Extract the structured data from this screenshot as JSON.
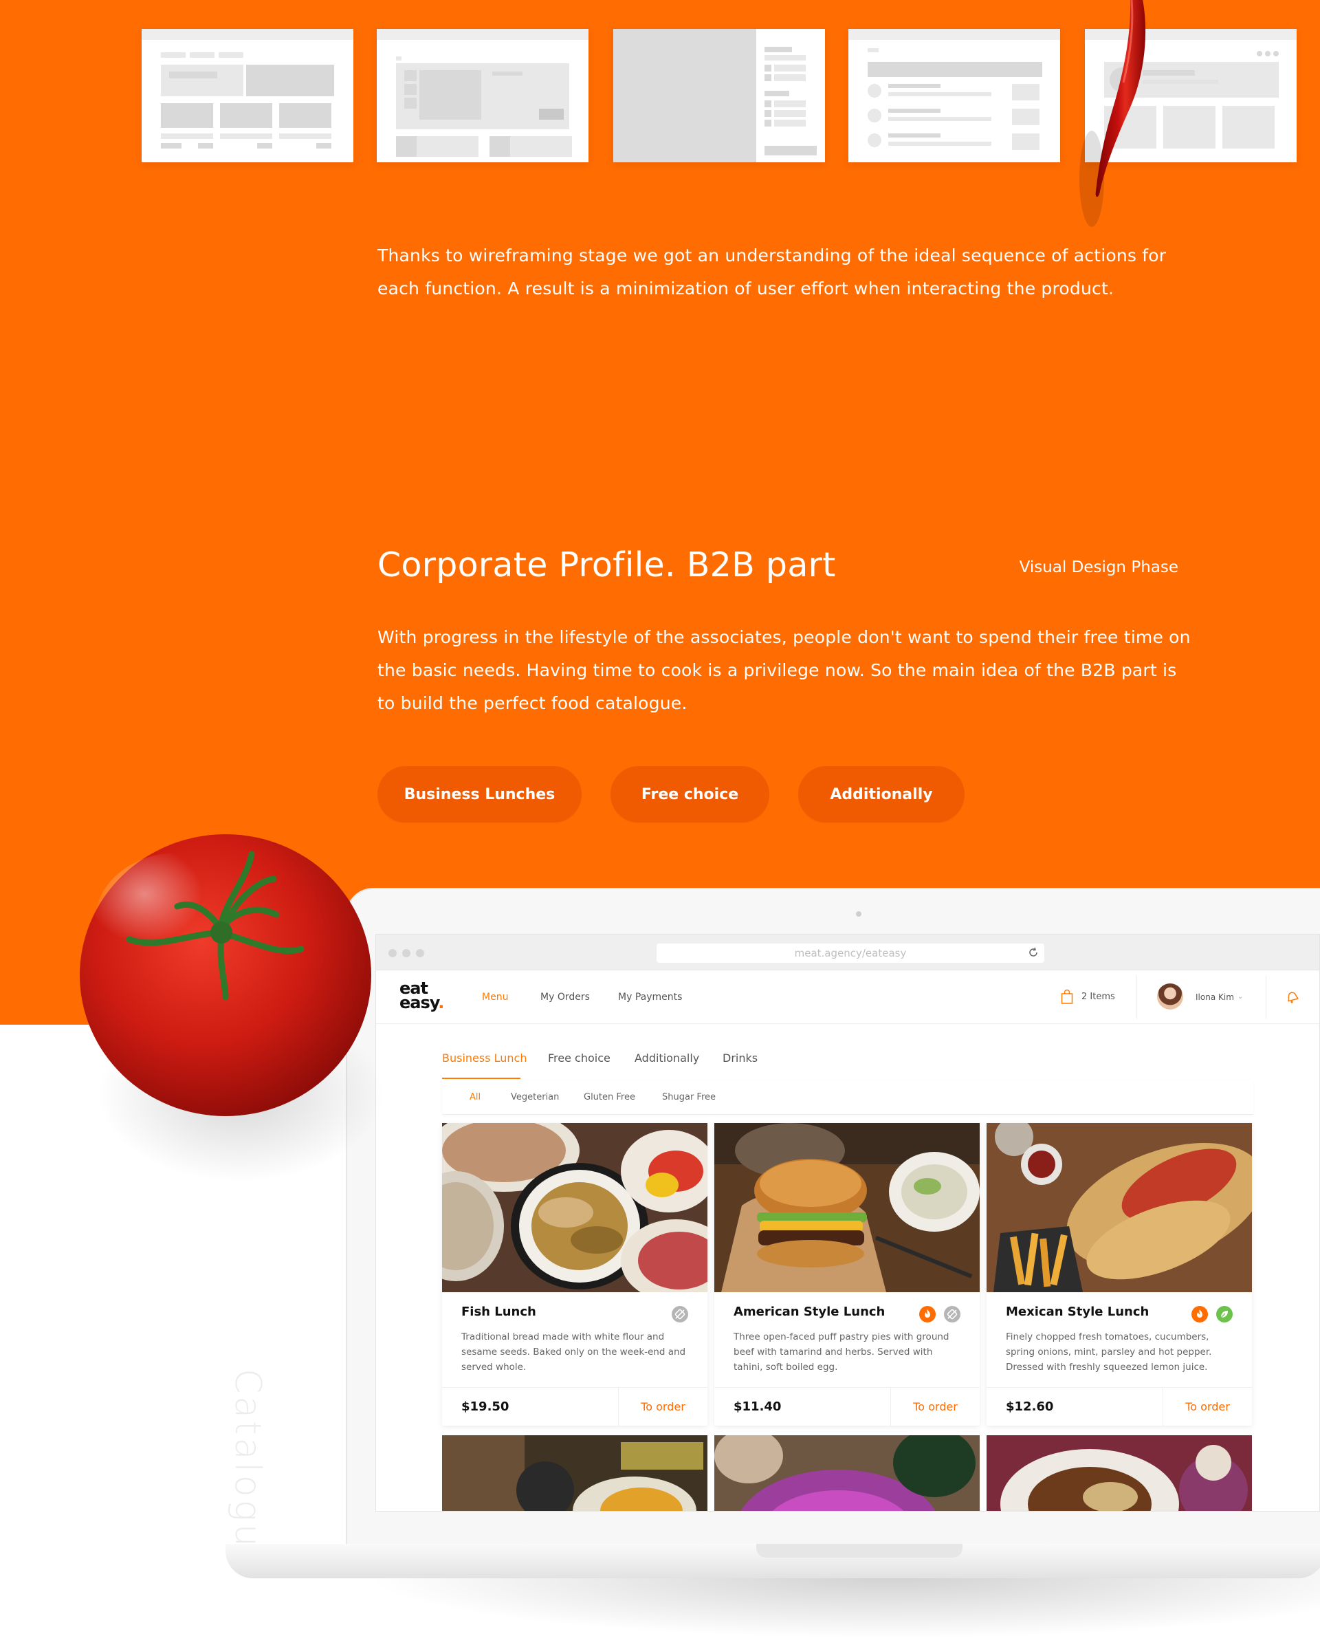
{
  "hero": {
    "paragraph1": "Thanks to wireframing stage we got an understanding of the ideal sequence of actions for each function. A result is a minimization of user effort when interacting the product.",
    "title": "Corporate Profile. B2B part",
    "phase": "Visual Design Phase",
    "paragraph2": "With progress in the lifestyle of the associates, people don't want to spend their free time on the basic needs. Having time to cook is a privilege now. So the main idea of the B2B part is to build the perfect food catalogue.",
    "pills": [
      "Business Lunches",
      "Free choice",
      "Additionally"
    ]
  },
  "side_label": "Catalogue",
  "browser": {
    "url": "meat.agency/eateasy"
  },
  "app": {
    "logo_line1": "eat",
    "logo_line2": "easy",
    "logo_dot": ".",
    "nav": [
      "Menu",
      "My Orders",
      "My Payments"
    ],
    "active_nav": "Menu",
    "cart_label": "2 Items",
    "user_name": "Ilona Kim",
    "tabs": [
      "Business Lunch",
      "Free choice",
      "Additionally",
      "Drinks"
    ],
    "active_tab": "Business Lunch",
    "filters": [
      "All",
      "Vegeterian",
      "Gluten Free",
      "Shugar Free"
    ],
    "active_filter": "All",
    "cards": [
      {
        "name": "Fish Lunch",
        "desc": "Traditional bread made with white flour and sesame seeds. Baked only on the week-end and served whole.",
        "price": "$19.50",
        "order": "To order",
        "badges": [
          "no-sugar-icon"
        ]
      },
      {
        "name": "American Style Lunch",
        "desc": "Three open-faced puff pastry pies with ground beef with tamarind and herbs. Served with tahini, soft boiled egg.",
        "price": "$11.40",
        "order": "To order",
        "badges": [
          "spicy-icon",
          "no-sugar-icon"
        ]
      },
      {
        "name": "Mexican Style Lunch",
        "desc": "Finely chopped fresh tomatoes, cucumbers, spring onions, mint, parsley and hot pepper. Dressed with freshly squeezed lemon juice.",
        "price": "$12.60",
        "order": "To order",
        "badges": [
          "spicy-icon",
          "vegetarian-icon"
        ]
      }
    ]
  },
  "colors": {
    "brand_orange": "#ff6c02",
    "pill_orange": "#f05a00",
    "accent": "#ff7a00",
    "vegetarian_green": "#6cc24a",
    "icon_gray": "#b5b5b5"
  }
}
